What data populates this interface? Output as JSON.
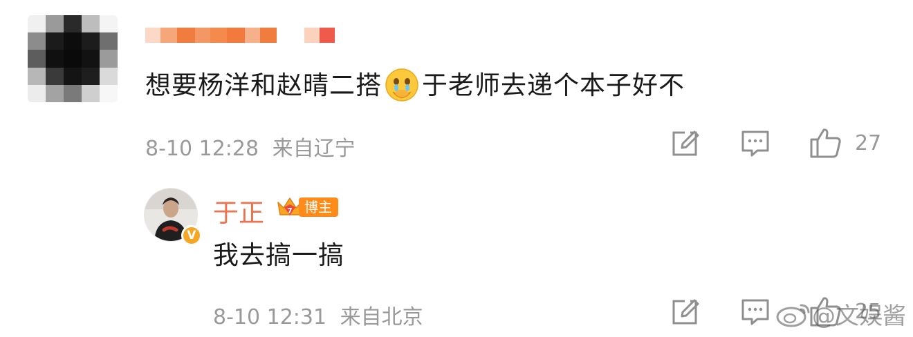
{
  "comment": {
    "text_before_emoji": "想要杨洋和赵晴二搭",
    "emoji": "crying-face-emoji",
    "text_after_emoji": "于老师去递个本子好不",
    "date": "8-10 12:28",
    "location": "来自辽宁",
    "like_count": "27"
  },
  "reply": {
    "author": "于正",
    "badge_level": "7",
    "badge_label": "博主",
    "verified_mark": "V",
    "text": "我去搞一搞",
    "date": "8-10 12:31",
    "location": "来自北京",
    "like_count": "25"
  },
  "watermark": {
    "text": "@文娱酱"
  },
  "colors": {
    "name_orange": "#eb7350",
    "meta_gray": "#999999",
    "badge_orange": "#ff8c1a",
    "verified_yellow": "#f6a623"
  }
}
